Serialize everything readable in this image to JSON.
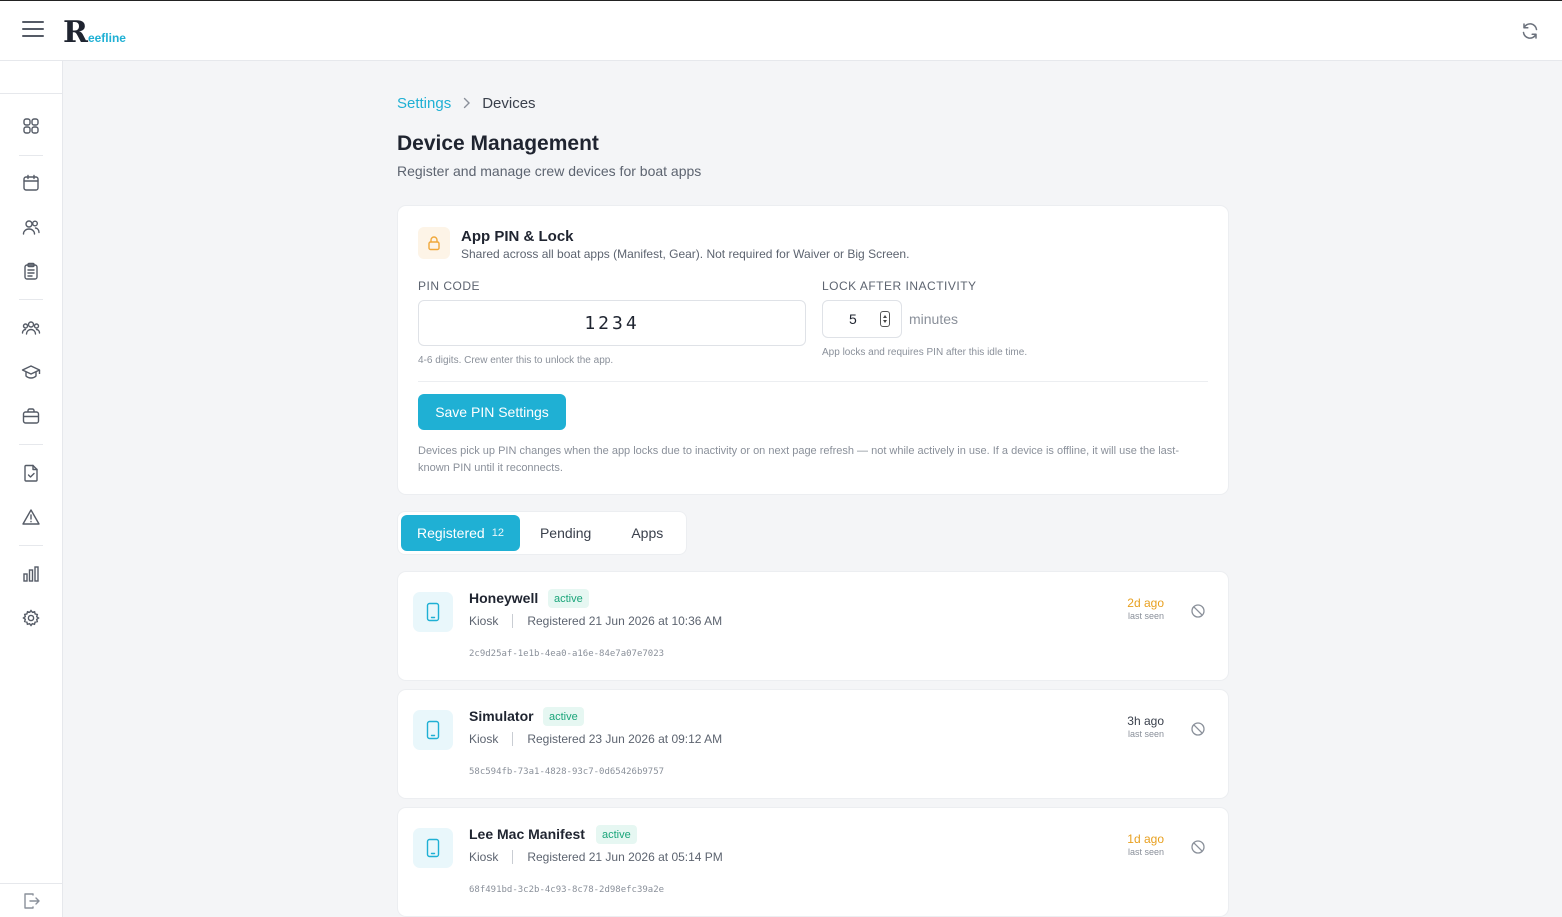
{
  "brand": {
    "mark": "R",
    "text": "eefline"
  },
  "breadcrumb": {
    "parent": "Settings",
    "current": "Devices"
  },
  "page": {
    "title": "Device Management",
    "subtitle": "Register and manage crew devices for boat apps"
  },
  "pin_card": {
    "title": "App PIN & Lock",
    "description": "Shared across all boat apps (Manifest, Gear). Not required for Waiver or Big Screen.",
    "pin_label": "PIN CODE",
    "pin_value": "1234",
    "pin_hint": "4-6 digits. Crew enter this to unlock the app.",
    "lock_label": "LOCK AFTER INACTIVITY",
    "lock_value": "5",
    "lock_unit": "minutes",
    "lock_hint": "App locks and requires PIN after this idle time.",
    "save_label": "Save PIN Settings",
    "note": "Devices pick up PIN changes when the app locks due to inactivity or on next page refresh — not while actively in use. If a device is offline, it will use the last-known PIN until it reconnects."
  },
  "tabs": [
    {
      "label": "Registered",
      "count": "12",
      "active": true
    },
    {
      "label": "Pending"
    },
    {
      "label": "Apps"
    }
  ],
  "devices": [
    {
      "name": "Honeywell",
      "status": "active",
      "type": "Kiosk",
      "registered": "Registered 21 Jun 2026 at 10:36 AM",
      "uuid": "2c9d25af-1e1b-4ea0-a16e-84e7a07e7023",
      "last_seen": "2d ago",
      "last_seen_label": "last seen",
      "seen_color": "#e8a020"
    },
    {
      "name": "Simulator",
      "status": "active",
      "type": "Kiosk",
      "registered": "Registered 23 Jun 2026 at 09:12 AM",
      "uuid": "58c594fb-73a1-4828-93c7-0d65426b9757",
      "last_seen": "3h ago",
      "last_seen_label": "last seen",
      "seen_color": "#3a404c"
    },
    {
      "name": "Lee Mac Manifest",
      "status": "active",
      "type": "Kiosk",
      "registered": "Registered 21 Jun 2026 at 05:14 PM",
      "uuid": "68f491bd-3c2b-4c93-8c78-2d98efc39a2e",
      "last_seen": "1d ago",
      "last_seen_label": "last seen",
      "seen_color": "#e8a020"
    }
  ],
  "icons": [
    "menu-icon",
    "refresh-icon",
    "dashboard-icon",
    "calendar-icon",
    "users-icon",
    "clipboard-icon",
    "group-icon",
    "graduation-cap-icon",
    "briefcase-icon",
    "file-check-icon",
    "warning-icon",
    "bar-chart-icon",
    "settings-icon",
    "logout-icon",
    "lock-icon",
    "phone-icon",
    "block-icon"
  ],
  "colors": {
    "accent": "#1fb0d4",
    "warning": "#e8a020",
    "active_badge_bg": "#e6f7f2",
    "active_badge_text": "#1aa57a"
  }
}
